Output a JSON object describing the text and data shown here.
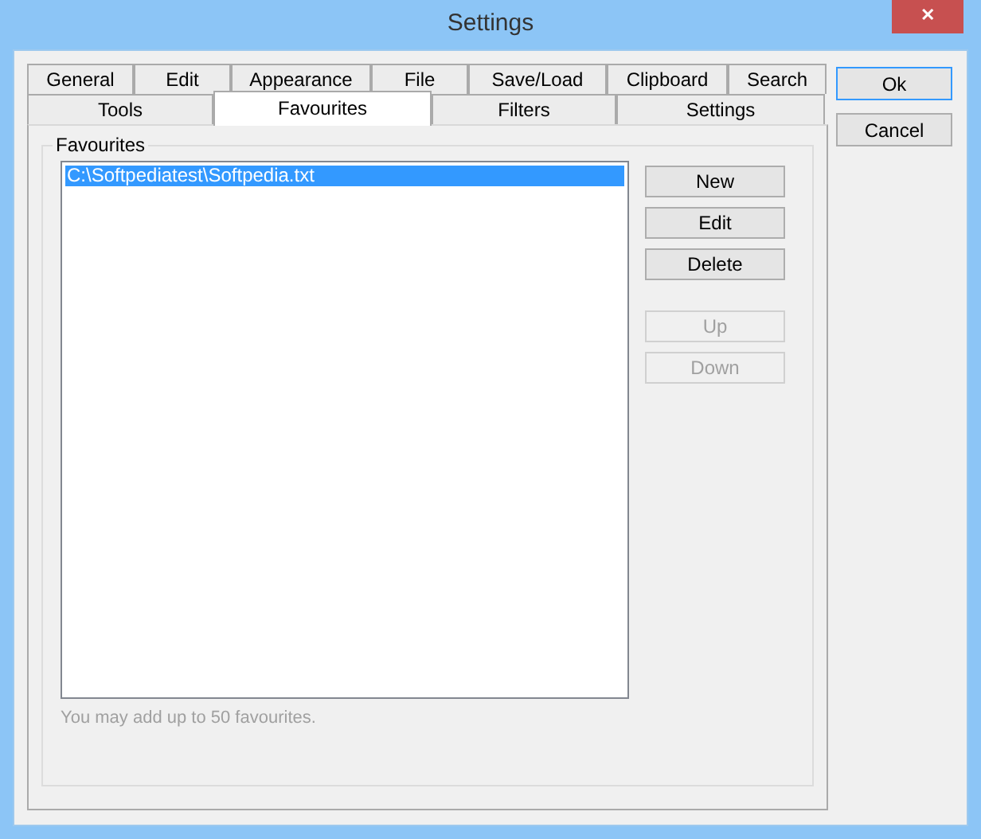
{
  "window": {
    "title": "Settings",
    "close": "✕"
  },
  "tabs": [
    [
      {
        "label": "General",
        "selected": false
      },
      {
        "label": "Edit",
        "selected": false
      },
      {
        "label": "Appearance",
        "selected": false
      },
      {
        "label": "File",
        "selected": false
      },
      {
        "label": "Save/Load",
        "selected": false
      },
      {
        "label": "Clipboard",
        "selected": false
      },
      {
        "label": "Search",
        "selected": false
      }
    ],
    [
      {
        "label": "Tools",
        "selected": false
      },
      {
        "label": "Favourites",
        "selected": true
      },
      {
        "label": "Filters",
        "selected": false
      },
      {
        "label": "Settings",
        "selected": false
      }
    ]
  ],
  "group": {
    "title": "Favourites",
    "items": [
      {
        "label": "C:\\Softpediatest\\Softpedia.txt",
        "selected": true
      }
    ],
    "buttons": [
      {
        "label": "New",
        "disabled": false
      },
      {
        "label": "Edit",
        "disabled": false
      },
      {
        "label": "Delete",
        "disabled": false
      },
      {
        "label": "Up",
        "disabled": true
      },
      {
        "label": "Down",
        "disabled": true
      }
    ],
    "hint": "You may add up to 50 favourites."
  },
  "dialog_buttons": [
    {
      "label": "Ok",
      "default": true
    },
    {
      "label": "Cancel",
      "default": false
    }
  ]
}
